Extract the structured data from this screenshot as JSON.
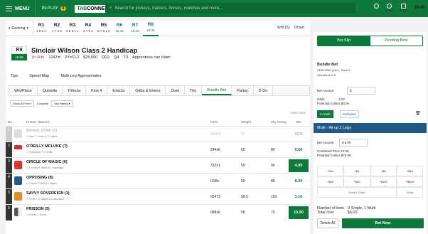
{
  "topbar": {
    "menu_label": "MENU",
    "inplay_label": "IN-PLAY",
    "inplay_count": "4",
    "logo_a": "TAB",
    "logo_b": "CONNECT",
    "search_placeholder": "Search for jockeys, trainers, horses, matches and more...",
    "icons": [
      {
        "name": "trophy-icon",
        "label": ""
      },
      {
        "name": "audio-icon",
        "label": "AUDIO"
      },
      {
        "name": "video-icon",
        "label": "VIDEO"
      }
    ],
    "balance": "$9.00"
  },
  "venue": {
    "name": "Geelong"
  },
  "races": [
    {
      "label": "R1",
      "time": "1 5 6 2"
    },
    {
      "label": "R2",
      "time": "1 7 4 5"
    },
    {
      "label": "R3",
      "time": "2 6 8 1 1"
    },
    {
      "label": "R4",
      "time": "2 7 9 1"
    },
    {
      "label": "R5",
      "time": "5 7 6 1 5"
    },
    {
      "label": "R6",
      "time": "15:45"
    },
    {
      "label": "R7",
      "time": "16:15"
    },
    {
      "label": "R8",
      "time": "16:45"
    }
  ],
  "track": {
    "condition": "Soft (5)",
    "weather": "Ocast"
  },
  "race": {
    "num": "R8",
    "time": "16:45",
    "name": "Sinclair Wilson Class 2 Handicap",
    "countdown": "1h 40m",
    "distance": "1247m",
    "class": "2Y=CL2",
    "prize": "$25,000",
    "meta": [
      "DD2",
      "Q4",
      "T3",
      "Apprentices can claim"
    ]
  },
  "subtabs": [
    "Tips",
    "Speed Map",
    "Multi Leg Approximates"
  ],
  "bettabs": [
    "Win/Place",
    "Quinella",
    "Trifecta",
    "First 4",
    "Exacta",
    "Odds & Evens",
    "Duet",
    "Trio",
    "Bundle Bet",
    "Parlay",
    "D Do"
  ],
  "filters": {
    "show_all": "Show All Form",
    "compare": "Compare",
    "compare_value": "Sky Rating"
  },
  "fixed_odds": "FIXED ODDS",
  "cols": {
    "no": "No",
    "runner": "Runner (Barrier)",
    "form": "Form",
    "weight": "Weight",
    "rating": "Sky Rating",
    "win": "Win"
  },
  "runners": [
    {
      "no": "1",
      "name": "BRAVE STAR (7)",
      "jt": "J: Allen  T: Lewis & T Cookes",
      "form": "3x553",
      "weight": "61",
      "rating": "",
      "win": "SCR"
    },
    {
      "no": "2",
      "name": "O'REILLY MCLUKE (7)",
      "jt": "J: P Moloney  T: C White",
      "form": "244x6",
      "weight": "60",
      "rating": "80",
      "win": "5.50"
    },
    {
      "no": "3",
      "name": "CIRCLE OF MAGIC (6)",
      "jt": "J: T Kerley  T: Ward & L Kavanagh",
      "form": "332x1",
      "weight": "59",
      "rating": "90",
      "win": "4.00"
    },
    {
      "no": "4",
      "name": "OPPOSING (8)",
      "jt": "J: L Nolen  T: Bell & J Hayes",
      "form": "f198x",
      "weight": "59",
      "rating": "89",
      "win": "8.00"
    },
    {
      "no": "5",
      "name": "SAVVY SOVEREIGN (1)",
      "jt": "J: R Hill  T: C Walker & D Buckland",
      "form": "62472",
      "weight": "58.5",
      "rating": "100",
      "win": "3.10"
    },
    {
      "no": "6",
      "name": "FRISSON (3)",
      "jt": "J: A Kelly  T: Zahra",
      "form": "088x6",
      "weight": "58",
      "rating": "70",
      "win": "15.00"
    }
  ],
  "betslip": {
    "tab_slip": "Bet Slip",
    "tab_pending": "Pending Bets",
    "bundle_title": "Bundle Bet",
    "bundle_venue": "GEELONG (VIC) - Race 8",
    "selections_label": "Selections",
    "selections_value": "3, 6",
    "bet_amount_label": "Bet Amount",
    "odds_label": "Odds",
    "odds_value": "3.22",
    "collect_label": "Potential Collect",
    "collect_value": "$0.00",
    "inmulti": "In Multi",
    "multiplier": "Multiplier!",
    "multi_title": "Multi - All up 2 Legs",
    "multi_amount": "$ 6.00",
    "combined_label": "Combined Price",
    "combined_value": "12.68",
    "mcollect_label": "Potential Collect",
    "mcollect_value": "$76.08",
    "stakes": [
      "+50c",
      "+$1",
      "+$5",
      "+$10",
      "+$20",
      "+$50",
      "+$100",
      "+$500"
    ],
    "done": "Done / Close",
    "clear": "Clear",
    "num_bets_label": "Number of bets",
    "num_bets_value": "0 Single, 1 Multi",
    "total_label": "Total cost",
    "total_value": "$6.00",
    "delete_all": "Delete All",
    "bet_now": "Bet Now"
  }
}
